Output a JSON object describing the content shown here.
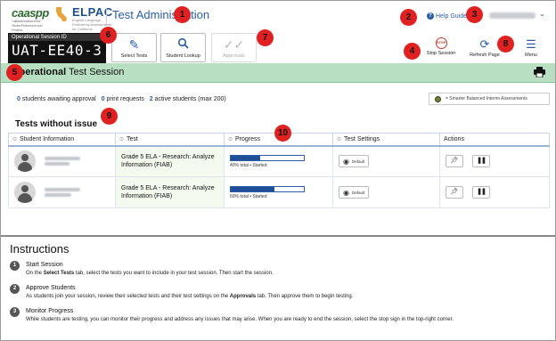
{
  "header": {
    "logo_caaspp": "caaspp",
    "logo_caaspp_sub": "California Assessment of Student Performance and Progress",
    "logo_elpac": "ELPAC",
    "logo_elpac_sub": "English Language Proficiency Assessments for California",
    "app_title": "Test Administration",
    "help_label": "Help Guide"
  },
  "session": {
    "label": "Operational Session ID",
    "id": "UAT-EE40-3"
  },
  "toolbar": {
    "select_tests": "Select Tests",
    "student_lookup": "Student Lookup",
    "approvals": "Approvals",
    "stop_session": "Stop Session",
    "stop_icon_text": "STOP",
    "refresh_page": "Refresh Page",
    "menu": "Menu"
  },
  "banner": {
    "prefix": "Operational",
    "suffix": " Test Session"
  },
  "stats": {
    "awaiting_count": "0",
    "awaiting_label": " students awaiting approval",
    "print_count": "0",
    "print_label": " print requests",
    "active_count": "2",
    "active_label": " active students (max 200)"
  },
  "legend": {
    "text": "= Smarter Balanced Interim Assessments"
  },
  "section_title": "Tests without issue",
  "table": {
    "headers": [
      "Student Information",
      "Test",
      "Progress",
      "Test Settings",
      "Actions"
    ],
    "rows": [
      {
        "test": "Grade 5 ELA - Research: Analyze Information (FIAB)",
        "progress_pct": 40,
        "progress_text": "40% total • Started",
        "settings": "Default"
      },
      {
        "test": "Grade 5 ELA - Research: Analyze Information (FIAB)",
        "progress_pct": 60,
        "progress_text": "60% total • Started",
        "settings": "Default"
      }
    ]
  },
  "instructions": {
    "title": "Instructions",
    "steps": [
      {
        "num": "1",
        "heading": "Start Session",
        "d1": "On the ",
        "d2": "Select Tests",
        "d3": " tab, select the tests you want to include in your test session. Then start the session."
      },
      {
        "num": "2",
        "heading": "Approve Students",
        "d1": "As students join your session, review their selected tests and their test settings on the ",
        "d2": "Approvals",
        "d3": " tab. Then approve them to begin testing."
      },
      {
        "num": "3",
        "heading": "Monitor Progress",
        "d1": "While students are testing, you can monitor their progress and address any issues that may arise. When you are ready to end the session, select the stop sign in the top-right corner.",
        "d2": "",
        "d3": ""
      }
    ]
  },
  "callouts": [
    "1",
    "2",
    "3",
    "4",
    "5",
    "6",
    "7",
    "8",
    "9",
    "10"
  ],
  "colors": {
    "banner": "#b9dfc3",
    "link_blue": "#2b5ea7",
    "callout_red": "#e02121",
    "progress_fill": "#1f4f99"
  }
}
